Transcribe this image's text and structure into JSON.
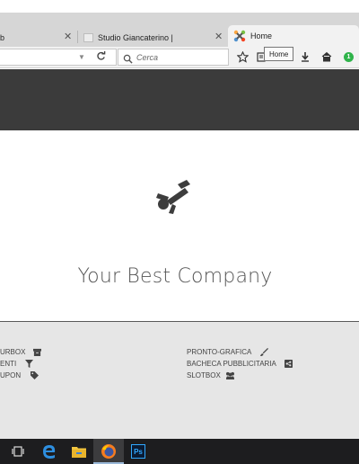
{
  "browser": {
    "tabs": [
      {
        "label": "b",
        "close": "✕"
      },
      {
        "label": "Studio Giancaterino |",
        "close": "✕"
      },
      {
        "label": "Home"
      }
    ],
    "search_placeholder": "Cerca",
    "tooltip": "Home",
    "badge_count": "1",
    "icons": [
      "bookmark-star-icon",
      "reading-list-icon",
      "download-icon",
      "home-icon",
      "reload-icon",
      "search-icon"
    ]
  },
  "page": {
    "company_name": "Your Best Company",
    "footer_left": [
      {
        "label": "URBOX",
        "icon": "archive-icon"
      },
      {
        "label": "ENTI",
        "icon": "filter-icon"
      },
      {
        "label": "UPON",
        "icon": "tag-icon"
      }
    ],
    "footer_right": [
      {
        "label": "PRONTO-GRAFICA",
        "icon": "brush-icon"
      },
      {
        "label": "BACHECA PUBBLICITARIA",
        "icon": "share-icon"
      },
      {
        "label": "SLOTBOX",
        "icon": "users-icon"
      }
    ]
  },
  "taskbar": {
    "apps": [
      "task-view-icon",
      "edge-icon",
      "file-explorer-icon",
      "firefox-icon",
      "photoshop-icon"
    ],
    "photoshop_label": "Ps"
  },
  "colors": {
    "header_dark": "#3b3b3b",
    "footer_bg": "#e6e6e6",
    "badge_green": "#2fb34a",
    "taskbar": "#1d1d1f"
  }
}
